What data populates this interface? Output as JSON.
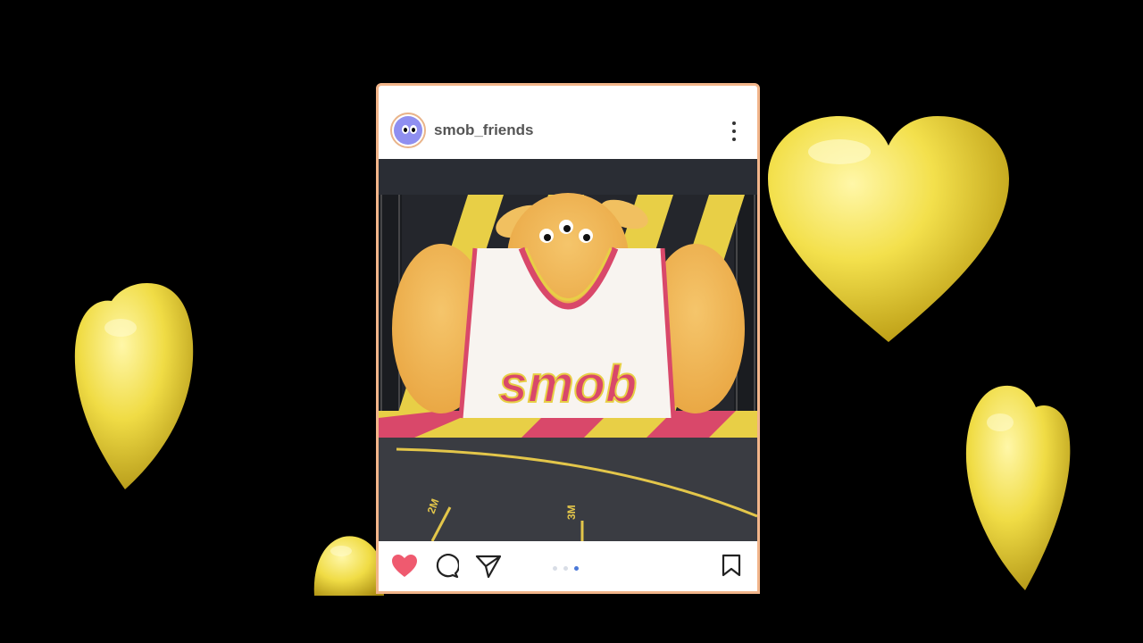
{
  "post": {
    "username": "smob_friends",
    "photo_caption_text": "smob",
    "court_marks": [
      "2M",
      "3M"
    ],
    "carousel": {
      "total": 3,
      "active": 3
    },
    "liked": true
  },
  "colors": {
    "background": "#000000",
    "heart_balloon": "#f2e04a",
    "like": "#ef5a6f",
    "pager_active": "#4a78d8",
    "frame": "#f2b58a"
  },
  "icons": [
    "heart-balloon-icon",
    "more-options-icon",
    "like-heart-icon",
    "comment-icon",
    "share-icon",
    "bookmark-icon"
  ]
}
